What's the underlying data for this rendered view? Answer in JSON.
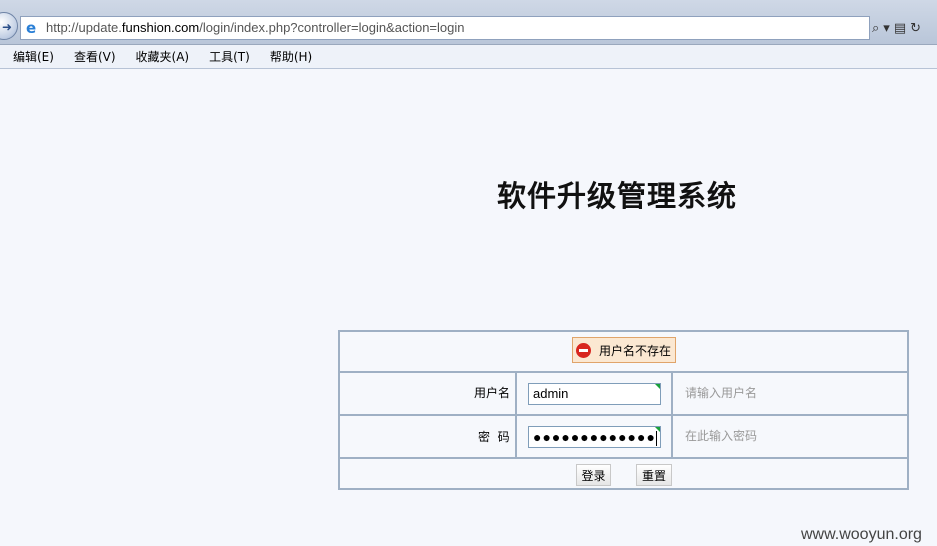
{
  "browser": {
    "url_prefix": "http://update.",
    "url_domain": "funshion.com",
    "url_path": "/login/index.php?controller=login&action=login",
    "icons": [
      "back-arrow-icon",
      "ie-logo-icon",
      "search-icon",
      "dropdown-icon",
      "compatibility-icon",
      "refresh-icon"
    ]
  },
  "menu": {
    "items": [
      {
        "label": "编辑(E)"
      },
      {
        "label": "查看(V)"
      },
      {
        "label": "收藏夹(A)"
      },
      {
        "label": "工具(T)"
      },
      {
        "label": "帮助(H)"
      }
    ]
  },
  "page": {
    "title": "软件升级管理系统"
  },
  "login_form": {
    "error_message": "用户名不存在",
    "username_label": "用户名",
    "username_value": "admin",
    "username_hint": "请输入用户名",
    "password_label": "密  码",
    "password_masked": "●●●●●●●●●●●●●",
    "password_hint": "在此输入密码",
    "login_button": "登录",
    "reset_button": "重置"
  },
  "watermark": "www.wooyun.org",
  "colors": {
    "page_background": "#f5f7fc",
    "table_border": "#9fb0c4",
    "error_icon": "#d8261f",
    "input_corner": "#1aa03a"
  }
}
